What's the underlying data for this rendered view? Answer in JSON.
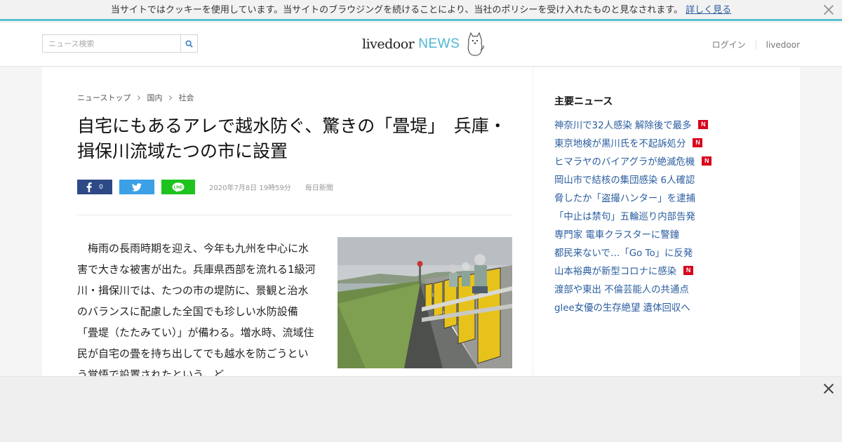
{
  "cookie": {
    "message": "当サイトではクッキーを使用しています。当サイトのブラウジングを続けることにより、当社のポリシーを受け入れたものと見なされます。",
    "link": "詳しく見る"
  },
  "header": {
    "search_placeholder": "ニュース検索",
    "logo_text": "livedoor",
    "logo_news": "NEWS",
    "login": "ログイン",
    "livedoor_link": "livedoor"
  },
  "breadcrumb": [
    "ニューストップ",
    "国内",
    "社会"
  ],
  "article": {
    "title": "自宅にもあるアレで越水防ぐ、驚きの「畳堤」　兵庫・揖保川流域たつの市に設置",
    "fb_count": "0",
    "date": "2020年7月8日 19時59分",
    "source": "毎日新聞",
    "body": "　梅雨の長雨時期を迎え、今年も九州を中心に水害で大きな被害が出た。兵庫県西部を流れる1級河川・揖保川では、たつの市の堤防に、景観と治水のバランスに配慮した全国でも珍しい水防設備「畳堤（たたみてい）」が備わる。増水時、流域住民が自宅の畳を持ち出してでも越水を防ごうという覚悟で設置されたという。ど"
  },
  "sidebar": {
    "heading": "主要ニュース",
    "items": [
      {
        "text": "神奈川で32人感染 解除後で最多",
        "badge": "N"
      },
      {
        "text": "東京地検が黒川氏を不起訴処分",
        "badge": "N"
      },
      {
        "text": "ヒマラヤのバイアグラが絶滅危機",
        "badge": "N"
      },
      {
        "text": "岡山市で結核の集団感染 6人確認",
        "badge": ""
      },
      {
        "text": "脅したか「盗撮ハンター」を逮捕",
        "badge": ""
      },
      {
        "text": "「中止は禁句」五輪巡り内部告発",
        "badge": ""
      },
      {
        "text": "専門家 電車クラスターに警鐘",
        "badge": ""
      },
      {
        "text": "都民来ないで…「Go To」に反発",
        "badge": ""
      },
      {
        "text": "山本裕典が新型コロナに感染",
        "badge": "N"
      },
      {
        "text": "渡部や東出 不倫芸能人の共通点",
        "badge": ""
      },
      {
        "text": "glee女優の生存絶望 遺体回収へ",
        "badge": ""
      }
    ]
  },
  "colors": {
    "accent": "#5bbfcf",
    "link": "#2a5d9f",
    "facebook": "#2d4a87",
    "twitter": "#3ba0e6",
    "line": "#1ec31e",
    "badge": "#d9001b"
  }
}
